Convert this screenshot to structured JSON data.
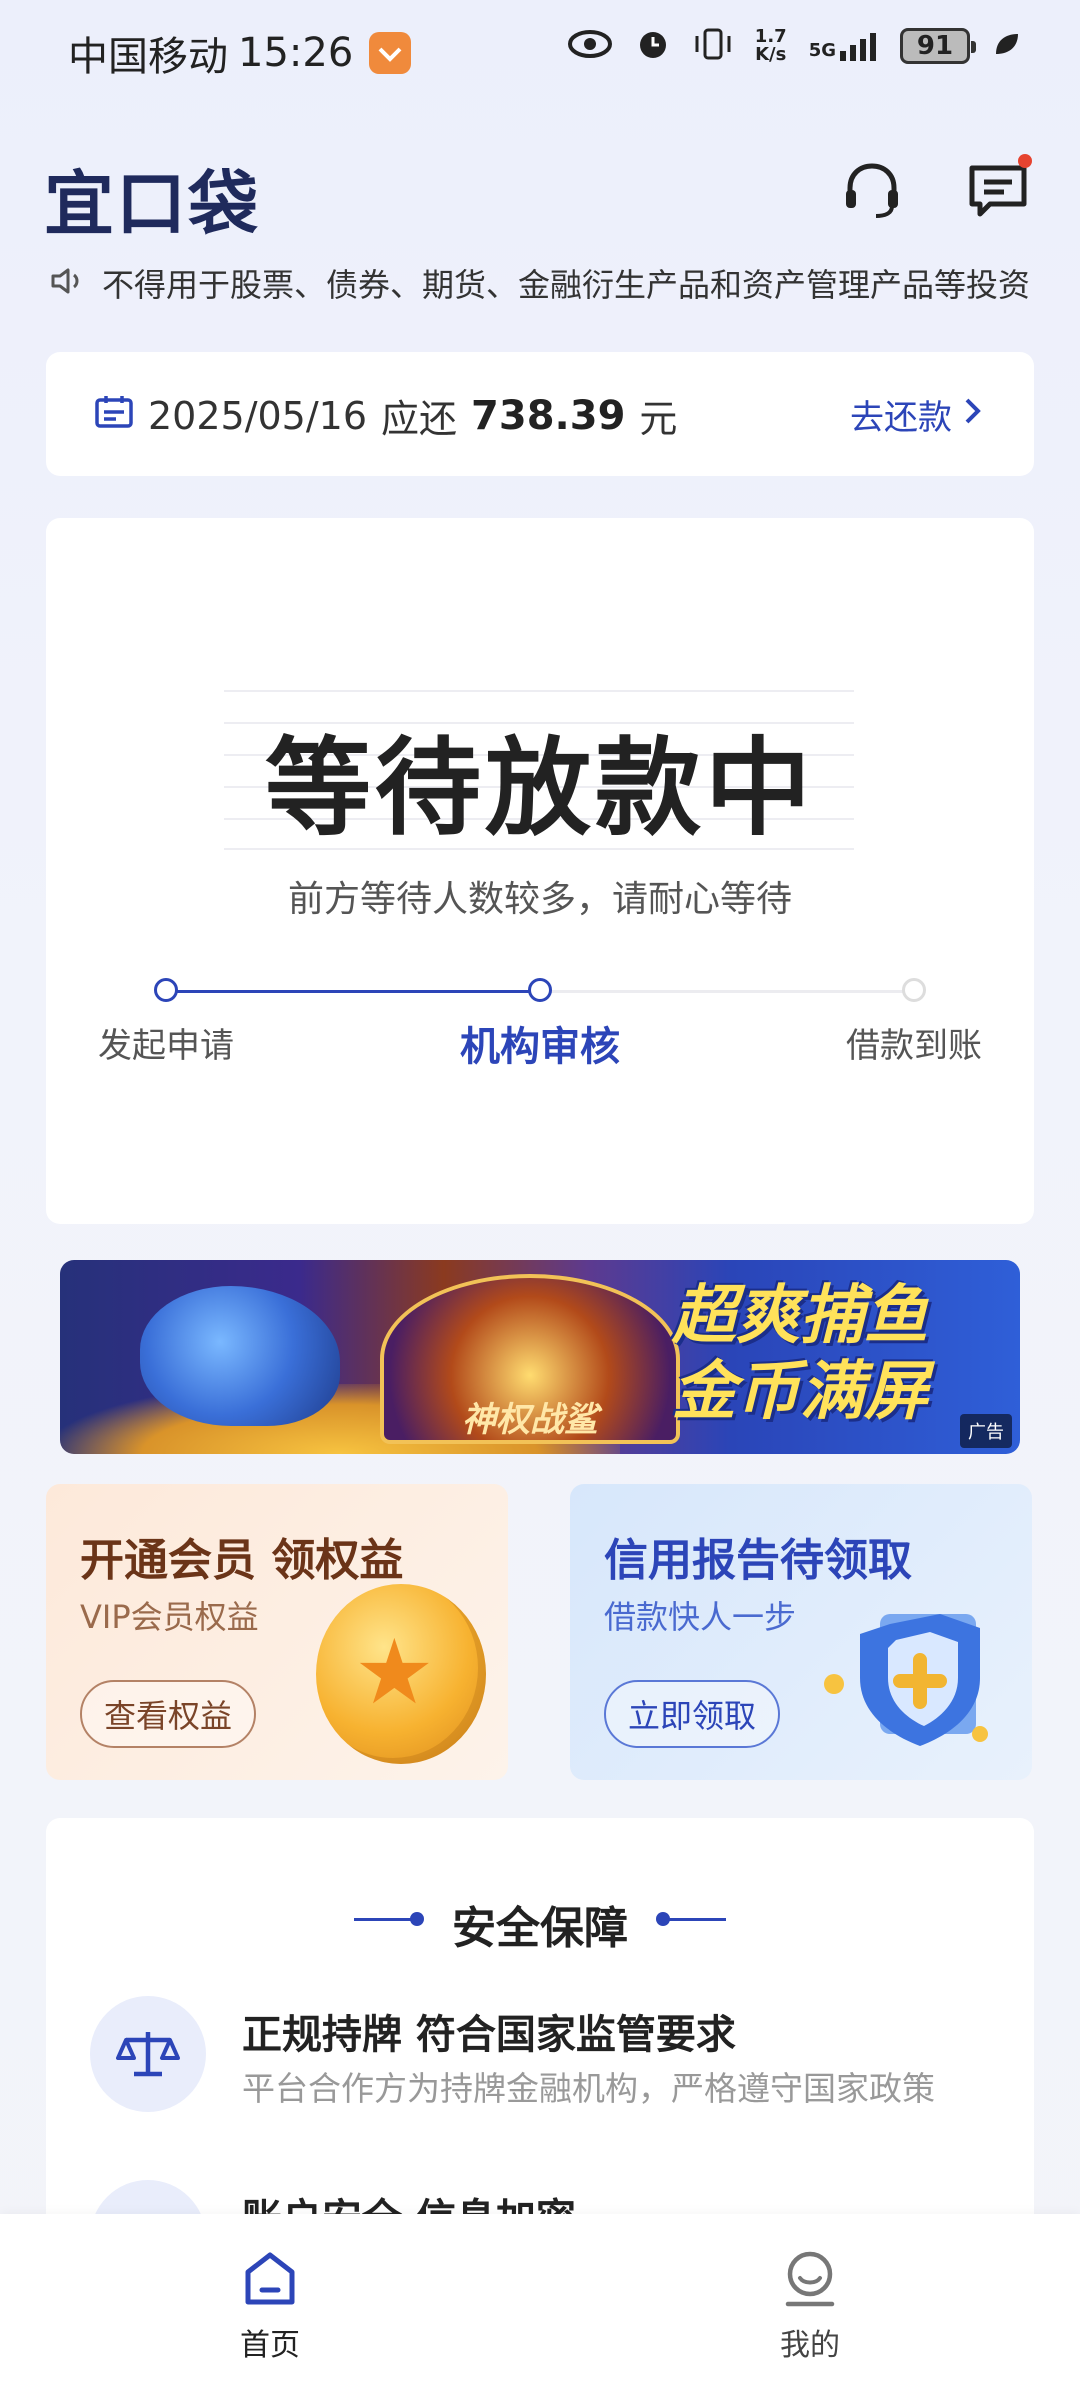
{
  "status_bar": {
    "carrier": "中国移动",
    "time": "15:26",
    "net_speed_value": "1.7",
    "net_speed_unit": "K/s",
    "signal": "5G",
    "battery": "91"
  },
  "header": {
    "logo": "宜口袋",
    "icons": [
      "headset-icon",
      "message-icon"
    ]
  },
  "notice": {
    "text": "不得用于股票、债券、期货、金融衍生产品和资产管理产品等投资"
  },
  "repay": {
    "date": "2025/05/16",
    "due_label": "应还",
    "amount": "738.39",
    "unit": "元",
    "action": "去还款"
  },
  "loan_status": {
    "title": "等待放款中",
    "subtitle": "前方等待人数较多，请耐心等待",
    "steps": [
      {
        "label": "发起申请",
        "state": "done"
      },
      {
        "label": "机构审核",
        "state": "active"
      },
      {
        "label": "借款到账",
        "state": "todo"
      }
    ],
    "progress_fraction": 0.5
  },
  "banner_ad": {
    "wheel_text": "神权战鲨",
    "slogan_line1": "超爽捕鱼",
    "slogan_line2": "金币满屏",
    "ad_tag": "广告"
  },
  "promos": {
    "vip": {
      "title": "开通会员 领权益",
      "subtitle": "VIP会员权益",
      "button": "查看权益"
    },
    "credit": {
      "title": "信用报告待领取",
      "subtitle": "借款快人一步",
      "button": "立即领取"
    }
  },
  "safety": {
    "title": "安全保障",
    "items": [
      {
        "heading": "正规持牌 符合国家监管要求",
        "desc": "平台合作方为持牌金融机构，严格遵守国家政策",
        "icon": "balance-scale-icon"
      },
      {
        "heading": "账户安全 信息加密",
        "desc": "",
        "icon": "shield-lock-icon"
      }
    ]
  },
  "bottom_nav": {
    "items": [
      {
        "label": "首页",
        "icon": "home-icon",
        "active": true
      },
      {
        "label": "我的",
        "icon": "profile-icon",
        "active": false
      }
    ]
  },
  "colors": {
    "accent": "#2c45b8",
    "logo": "#1f2a5c",
    "notification_dot": "#e6432f"
  }
}
